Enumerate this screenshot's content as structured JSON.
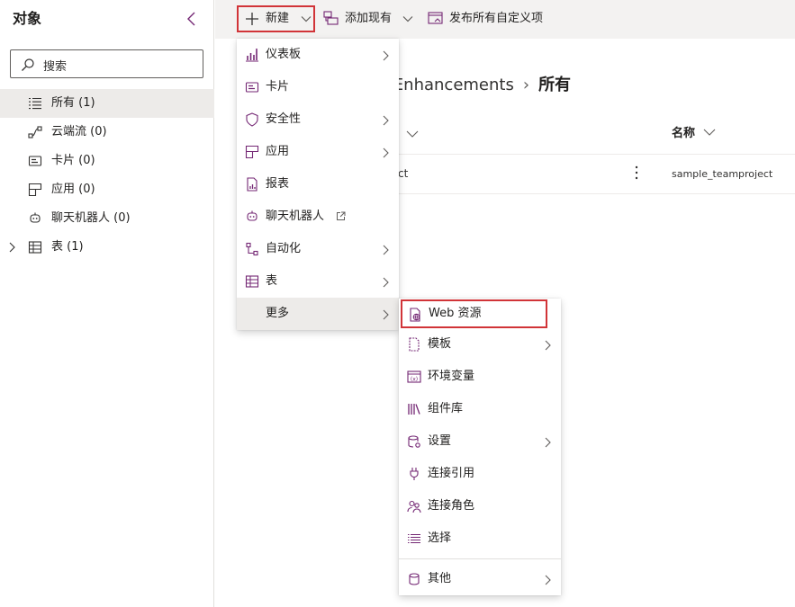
{
  "left_pane": {
    "title": "对象",
    "search_placeholder": "搜索",
    "items": [
      {
        "label": "所有 (1)"
      },
      {
        "label": "云端流 (0)"
      },
      {
        "label": "卡片 (0)"
      },
      {
        "label": "应用 (0)"
      },
      {
        "label": "聊天机器人 (0)"
      },
      {
        "label": "表 (1)"
      }
    ]
  },
  "toolbar": {
    "new_label": "新建",
    "add_existing_label": "添加现有",
    "publish_label": "发布所有自定义项"
  },
  "breadcrumb": {
    "partial_solution": "e Enhancements",
    "current": "所有"
  },
  "table": {
    "name_header": "名称",
    "row_partial_display": "ct",
    "row_name": "sample_teamproject"
  },
  "new_menu": {
    "items": [
      {
        "label": "仪表板",
        "icon": "dashboard-icon",
        "has_submenu": true
      },
      {
        "label": "卡片",
        "icon": "card-icon",
        "has_submenu": false
      },
      {
        "label": "安全性",
        "icon": "shield-icon",
        "has_submenu": true
      },
      {
        "label": "应用",
        "icon": "app-icon",
        "has_submenu": true
      },
      {
        "label": "报表",
        "icon": "report-icon",
        "has_submenu": false
      },
      {
        "label": "聊天机器人",
        "icon": "bot-icon",
        "has_submenu": false,
        "external": true
      },
      {
        "label": "自动化",
        "icon": "flow-icon",
        "has_submenu": true
      },
      {
        "label": "表",
        "icon": "table-icon",
        "has_submenu": true
      },
      {
        "label": "更多",
        "icon": "",
        "has_submenu": true,
        "active": true
      }
    ]
  },
  "more_submenu": {
    "items": [
      {
        "label": "Web 资源",
        "icon": "web-resource-icon"
      },
      {
        "label": "模板",
        "icon": "template-icon",
        "has_submenu": true
      },
      {
        "label": "环境变量",
        "icon": "env-variable-icon"
      },
      {
        "label": "组件库",
        "icon": "component-library-icon"
      },
      {
        "label": "设置",
        "icon": "settings-icon",
        "has_submenu": true
      },
      {
        "label": "连接引用",
        "icon": "connection-reference-icon"
      },
      {
        "label": "连接角色",
        "icon": "connection-role-icon"
      },
      {
        "label": "选择",
        "icon": "choice-icon"
      },
      {
        "label": "其他",
        "icon": "other-icon",
        "has_submenu": true
      }
    ]
  },
  "colors": {
    "accent": "#742774",
    "highlight_border": "#d13438",
    "command_bar": "#f3f2f1",
    "selected": "#edebe9"
  }
}
